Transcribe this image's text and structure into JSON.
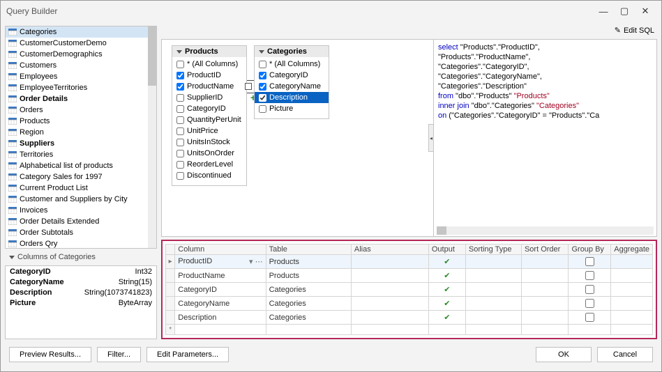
{
  "window": {
    "title": "Query Builder"
  },
  "toolbar": {
    "edit_sql": "Edit SQL"
  },
  "tree": {
    "items": [
      {
        "label": "Categories",
        "selected": true
      },
      {
        "label": "CustomerCustomerDemo"
      },
      {
        "label": "CustomerDemographics"
      },
      {
        "label": "Customers"
      },
      {
        "label": "Employees"
      },
      {
        "label": "EmployeeTerritories"
      },
      {
        "label": "Order Details",
        "bold": true
      },
      {
        "label": "Orders"
      },
      {
        "label": "Products"
      },
      {
        "label": "Region"
      },
      {
        "label": "Suppliers",
        "bold": true
      },
      {
        "label": "Territories"
      },
      {
        "label": "Alphabetical list of products"
      },
      {
        "label": "Category Sales for 1997"
      },
      {
        "label": "Current Product List"
      },
      {
        "label": "Customer and Suppliers by City"
      },
      {
        "label": "Invoices"
      },
      {
        "label": "Order Details Extended"
      },
      {
        "label": "Order Subtotals"
      },
      {
        "label": "Orders Qry"
      }
    ]
  },
  "columns_section": {
    "title": "Columns of Categories"
  },
  "props": [
    {
      "k": "CategoryID",
      "v": "Int32"
    },
    {
      "k": "CategoryName",
      "v": "String(15)"
    },
    {
      "k": "Description",
      "v": "String(1073741823)"
    },
    {
      "k": "Picture",
      "v": "ByteArray"
    }
  ],
  "cards": {
    "products": {
      "title": "Products",
      "fields": [
        {
          "label": "* (All Columns)",
          "checked": false
        },
        {
          "label": "ProductID",
          "checked": true
        },
        {
          "label": "ProductName",
          "checked": true
        },
        {
          "label": "SupplierID",
          "checked": false,
          "plus": true
        },
        {
          "label": "CategoryID",
          "checked": false
        },
        {
          "label": "QuantityPerUnit",
          "checked": false
        },
        {
          "label": "UnitPrice",
          "checked": false
        },
        {
          "label": "UnitsInStock",
          "checked": false
        },
        {
          "label": "UnitsOnOrder",
          "checked": false
        },
        {
          "label": "ReorderLevel",
          "checked": false
        },
        {
          "label": "Discontinued",
          "checked": false
        }
      ]
    },
    "categories": {
      "title": "Categories",
      "fields": [
        {
          "label": "* (All Columns)",
          "checked": false
        },
        {
          "label": "CategoryID",
          "checked": true
        },
        {
          "label": "CategoryName",
          "checked": true
        },
        {
          "label": "Description",
          "checked": true,
          "selected": true
        },
        {
          "label": "Picture",
          "checked": false
        }
      ]
    }
  },
  "sql": {
    "l1a": "select",
    "l1b": " \"Products\".\"ProductID\",",
    "l2": "       \"Products\".\"ProductName\",",
    "l3": "       \"Categories\".\"CategoryID\",",
    "l4": "       \"Categories\".\"CategoryName\",",
    "l5": "       \"Categories\".\"Description\"",
    "l6a": "from",
    "l6b": " \"dbo\".\"Products\" ",
    "l6c": "\"Products\"",
    "l7a": "  inner join",
    "l7b": " \"dbo\".\"Categories\" ",
    "l7c": "\"Categories\"",
    "l8a": "    on",
    "l8b": " (\"Categories\".\"CategoryID\" = \"Products\".\"Ca"
  },
  "grid": {
    "headers": {
      "column": "Column",
      "table": "Table",
      "alias": "Alias",
      "output": "Output",
      "sortingtype": "Sorting Type",
      "sortorder": "Sort Order",
      "groupby": "Group By",
      "aggregate": "Aggregate"
    },
    "rows": [
      {
        "column": "ProductID",
        "table": "Products",
        "output": true,
        "active": true,
        "marker": "▸",
        "dd": true
      },
      {
        "column": "ProductName",
        "table": "Products",
        "output": true
      },
      {
        "column": "CategoryID",
        "table": "Categories",
        "output": true
      },
      {
        "column": "CategoryName",
        "table": "Categories",
        "output": true
      },
      {
        "column": "Description",
        "table": "Categories",
        "output": true
      },
      {
        "column": "",
        "table": "",
        "marker": "*"
      }
    ]
  },
  "footer": {
    "preview": "Preview Results...",
    "filter": "Filter...",
    "params": "Edit Parameters...",
    "ok": "OK",
    "cancel": "Cancel"
  }
}
